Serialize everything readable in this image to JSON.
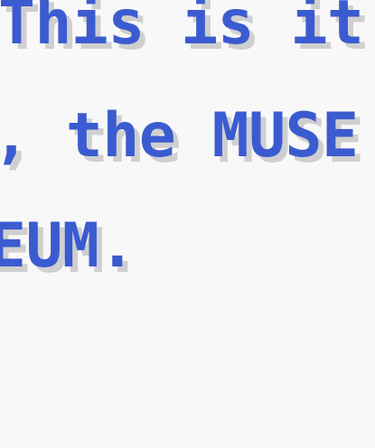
{
  "dialog": {
    "lines": [
      "This is it",
      ", the MUSE",
      "EUM."
    ]
  }
}
